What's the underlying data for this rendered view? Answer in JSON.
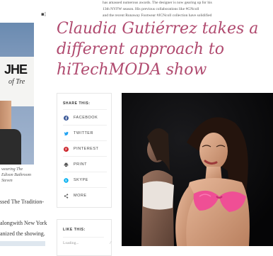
{
  "intro": {
    "lines": [
      "has amassed numerous awards. The designer is now gearing up for his",
      "13th NYFW season. His previous collaborations like #GNcoll",
      "and the recent Runaway Footwear #JCNcoll collection have solidified"
    ]
  },
  "headline": "Claudia Gutiérrez takes a different approach to hiTechMODA show",
  "left_column": {
    "banner_text": "JHE",
    "banner_sub": "of Tre",
    "caption_lines": [
      "wearing The",
      "Edison Bathroom",
      "Steven"
    ],
    "text_lines": [
      "ssed The Tradition-",
      "",
      "alongwith New York",
      "anized the showing.",
      "Tas Vilt Maitl"
    ]
  },
  "share": {
    "title": "SHARE THIS:",
    "items": [
      {
        "label": "FACEBOOK",
        "icon": "facebook-icon",
        "color": "#3b5998"
      },
      {
        "label": "TWITTER",
        "icon": "twitter-icon",
        "color": "#1da1f2"
      },
      {
        "label": "PINTEREST",
        "icon": "pinterest-icon",
        "color": "#cb2027"
      },
      {
        "label": "PRINT",
        "icon": "print-icon",
        "color": "#555555"
      },
      {
        "label": "SKYPE",
        "icon": "skype-icon",
        "color": "#00aff0"
      },
      {
        "label": "MORE",
        "icon": "share-icon",
        "color": "#555555"
      }
    ]
  },
  "like": {
    "title": "LIKE THIS:",
    "loading": "Loading..."
  },
  "colors": {
    "headline": "#b04a6f",
    "bikini": "#ef4f95"
  }
}
